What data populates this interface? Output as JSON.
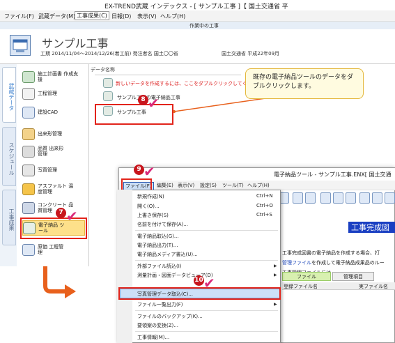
{
  "title_bar": {
    "text": "EX-TREND武蔵 インデックス - [ サンプル工事 ]【 国土交通省 平"
  },
  "menu_bar": {
    "file": "ファイル(F)",
    "musashi_data": "武蔵データ(M)",
    "construction_result": "工事成果(C)",
    "daily": "日報(D)",
    "view": "表示(V)",
    "help": "ヘルプ(H)"
  },
  "work_bar": {
    "label": "作業中の工事"
  },
  "project": {
    "title": "サンプル工事",
    "period": "工期 2014/11/04〜2014/12/26(着工前)  発注者名 国土〇〇省",
    "standard": "国土交通省 平成22年09月"
  },
  "side_tabs": [
    "武蔵データ",
    "スケジュール",
    "工事成果"
  ],
  "side_items": [
    {
      "label": "施工計画書 作成支援"
    },
    {
      "label": "工程管理"
    },
    {
      "label": "建設CAD"
    },
    {
      "label": "出来形管理"
    },
    {
      "label": "品質 出来形管理"
    },
    {
      "label": "写真管理"
    },
    {
      "label": "アスファルト 温度管理"
    },
    {
      "label": "コンクリート 品質管理"
    },
    {
      "label": "電子納品 ツール"
    },
    {
      "label": "原価 工程管理"
    }
  ],
  "data_list": {
    "header": "データ名称",
    "new_hint": "新しいデータを作成するには、ここをダブルクリックしてください。",
    "row1": "サンプル工事の電子納品工事",
    "row2": "サンプル工事"
  },
  "callout": {
    "text": "既存の電子納品ツールのデータをダブルクリックします。"
  },
  "badges": {
    "step7": "7",
    "step8": "8",
    "step9": "9",
    "step10": "10"
  },
  "window2": {
    "title": "電子納品ツール - サンプル工事.ENX[ 国土交通",
    "menu": {
      "file": "ファイル(F)",
      "edit": "編集(E)",
      "view": "表示(V)",
      "settings": "設定(S)",
      "tool": "ツール(T)",
      "help": "ヘルプ(H)"
    },
    "panel_title": "工事完成図",
    "text1": "工事完成図書の電子納品を作成する場合、打",
    "text2_link": "管理ファイル",
    "text2_rest": "を作成して電子納品成果品のルー",
    "text3": "工事管理ファイルには",
    "tab_file": "ファイル",
    "tab_manage": "管理項目",
    "col_registered": "登録ファイル名",
    "col_actual": "実ファイル名"
  },
  "file_menu": [
    {
      "label": "新規作成(N)",
      "shortcut": "Ctrl+N"
    },
    {
      "label": "開く(O)...",
      "shortcut": "Ctrl+O"
    },
    {
      "label": "上書き保存(S)",
      "shortcut": "Ctrl+S"
    },
    {
      "label": "名前を付けて保存(A)..."
    },
    {
      "label": "電子納品取込(G)..."
    },
    {
      "label": "電子納品出力(T)..."
    },
    {
      "label": "電子納品メディア書込(U)..."
    },
    {
      "label": "外部ファイル読込(I)"
    },
    {
      "label": "測量計画・図面データビューア(D)"
    },
    {
      "label": "写真管理データ取込(C)..."
    },
    {
      "label": "ファイル一覧出力(F)"
    },
    {
      "label": "ファイルのバックアップ(K)..."
    },
    {
      "label": "要領案の変換(Z)..."
    },
    {
      "label": "工事情報(M)..."
    }
  ],
  "colors": {
    "accent_red": "#e2231a",
    "badge_red": "#c8161d",
    "check_pink": "#d92a7a",
    "arrow_orange": "#e8601c",
    "title_blue": "#1a3fc2"
  }
}
